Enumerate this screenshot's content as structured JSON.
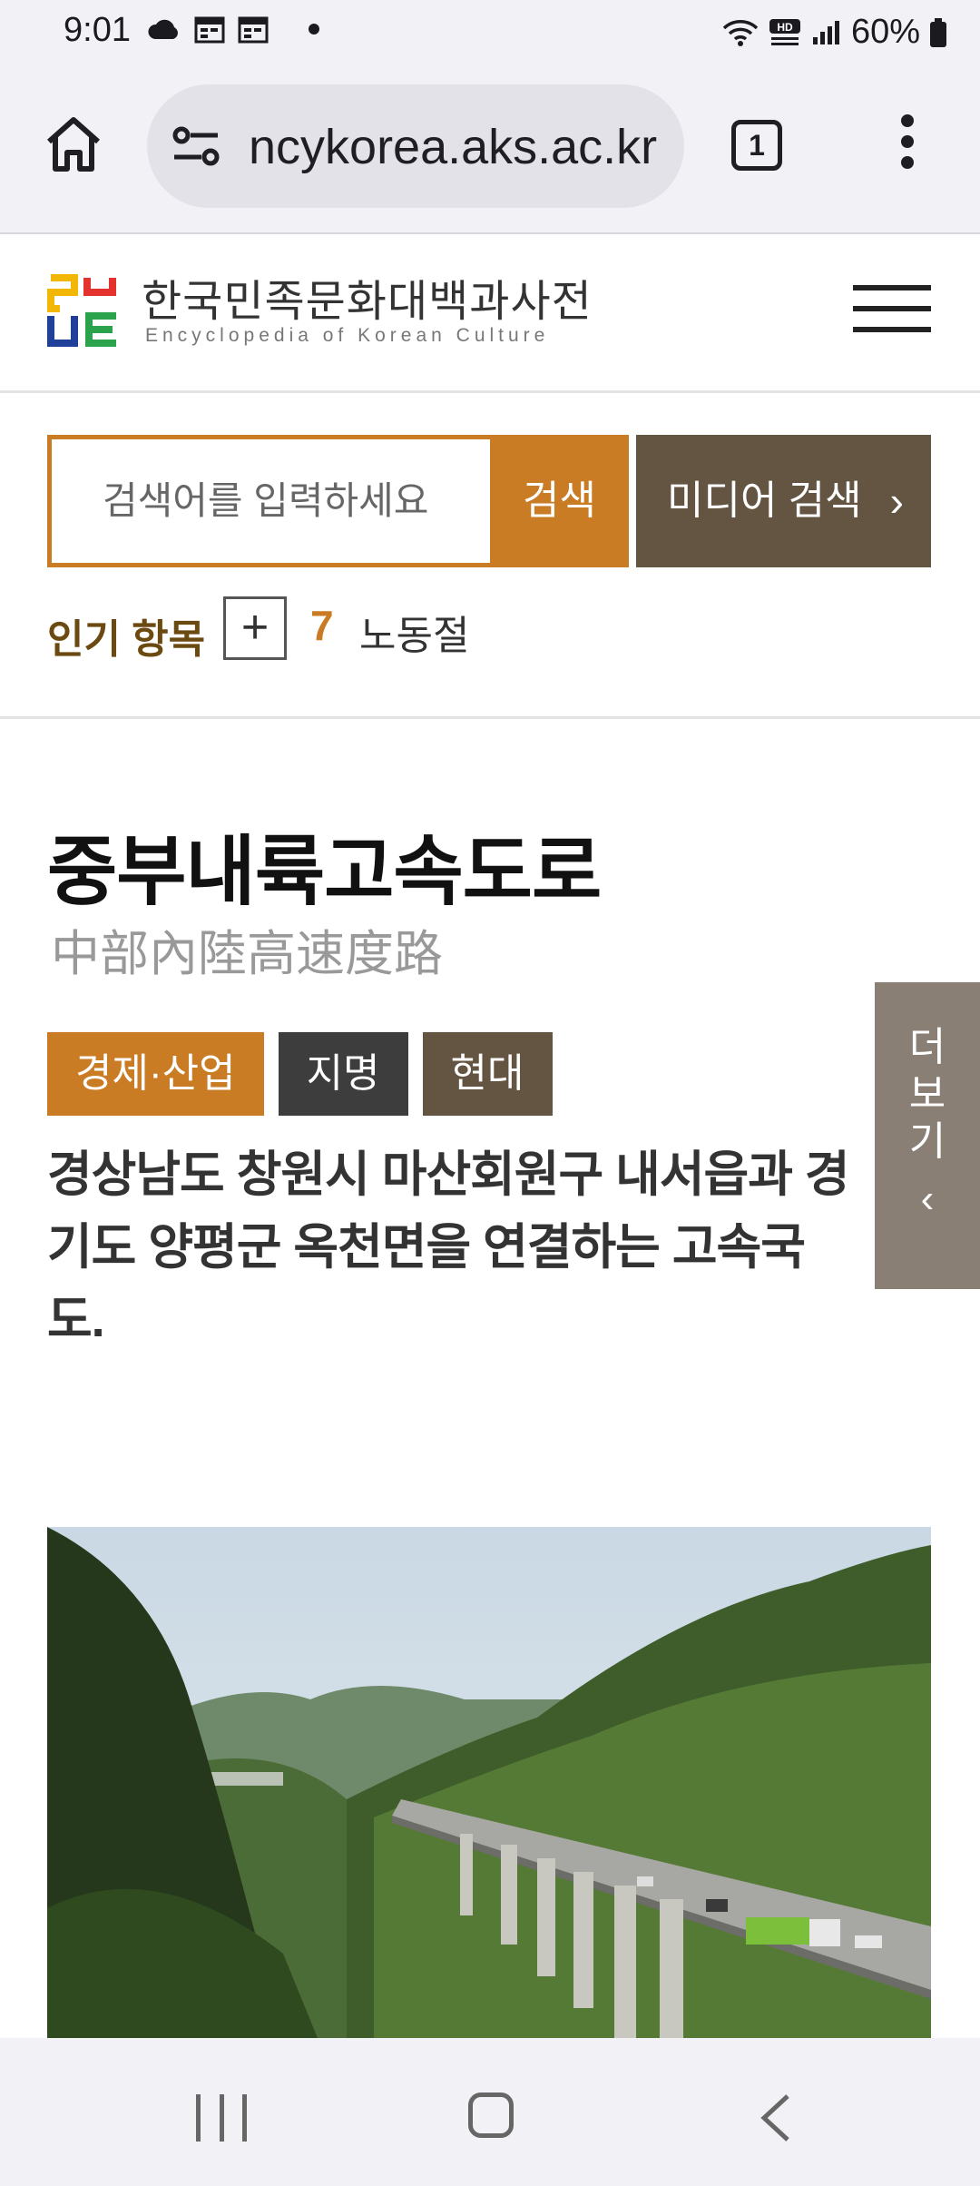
{
  "status_bar": {
    "time": "9:01",
    "battery": "60%",
    "icons": [
      "cloud-icon",
      "calendar-icon",
      "calendar-icon",
      "notification-dot-icon",
      "wifi-icon",
      "hd-voice-icon",
      "signal-icon",
      "battery-icon"
    ],
    "hd_voice_label": "HD"
  },
  "browser": {
    "url": "ncykorea.aks.ac.kr",
    "tab_count": "1"
  },
  "site": {
    "title": "한국민족문화대백과사전",
    "subtitle": "Encyclopedia of Korean Culture",
    "brand_colors": [
      "#f2b705",
      "#e4332f",
      "#1f3f99",
      "#2ba24c"
    ]
  },
  "search": {
    "placeholder": "검색어를 입력하세요",
    "button_label": "검색",
    "media_button_label": "미디어 검색",
    "media_button_chevron": "›"
  },
  "popular": {
    "label": "인기 항목",
    "expand_symbol": "+",
    "rank": "7",
    "term": "노동절"
  },
  "article": {
    "title": "중부내륙고속도로",
    "hanja": "中部內陸高速度路",
    "tags": [
      "경제·산업",
      "지명",
      "현대"
    ],
    "summary": "경상남도 창원시 마산회원구 내서읍과 경기도 양평군 옥천면을 연결하는 고속국도.",
    "more_label": "더보기",
    "more_chevron": "‹"
  },
  "colors": {
    "accent": "#c97c24",
    "dark_brown": "#645442",
    "tag_dark": "#3d3d3d",
    "side_tab": "#8a7f74"
  }
}
